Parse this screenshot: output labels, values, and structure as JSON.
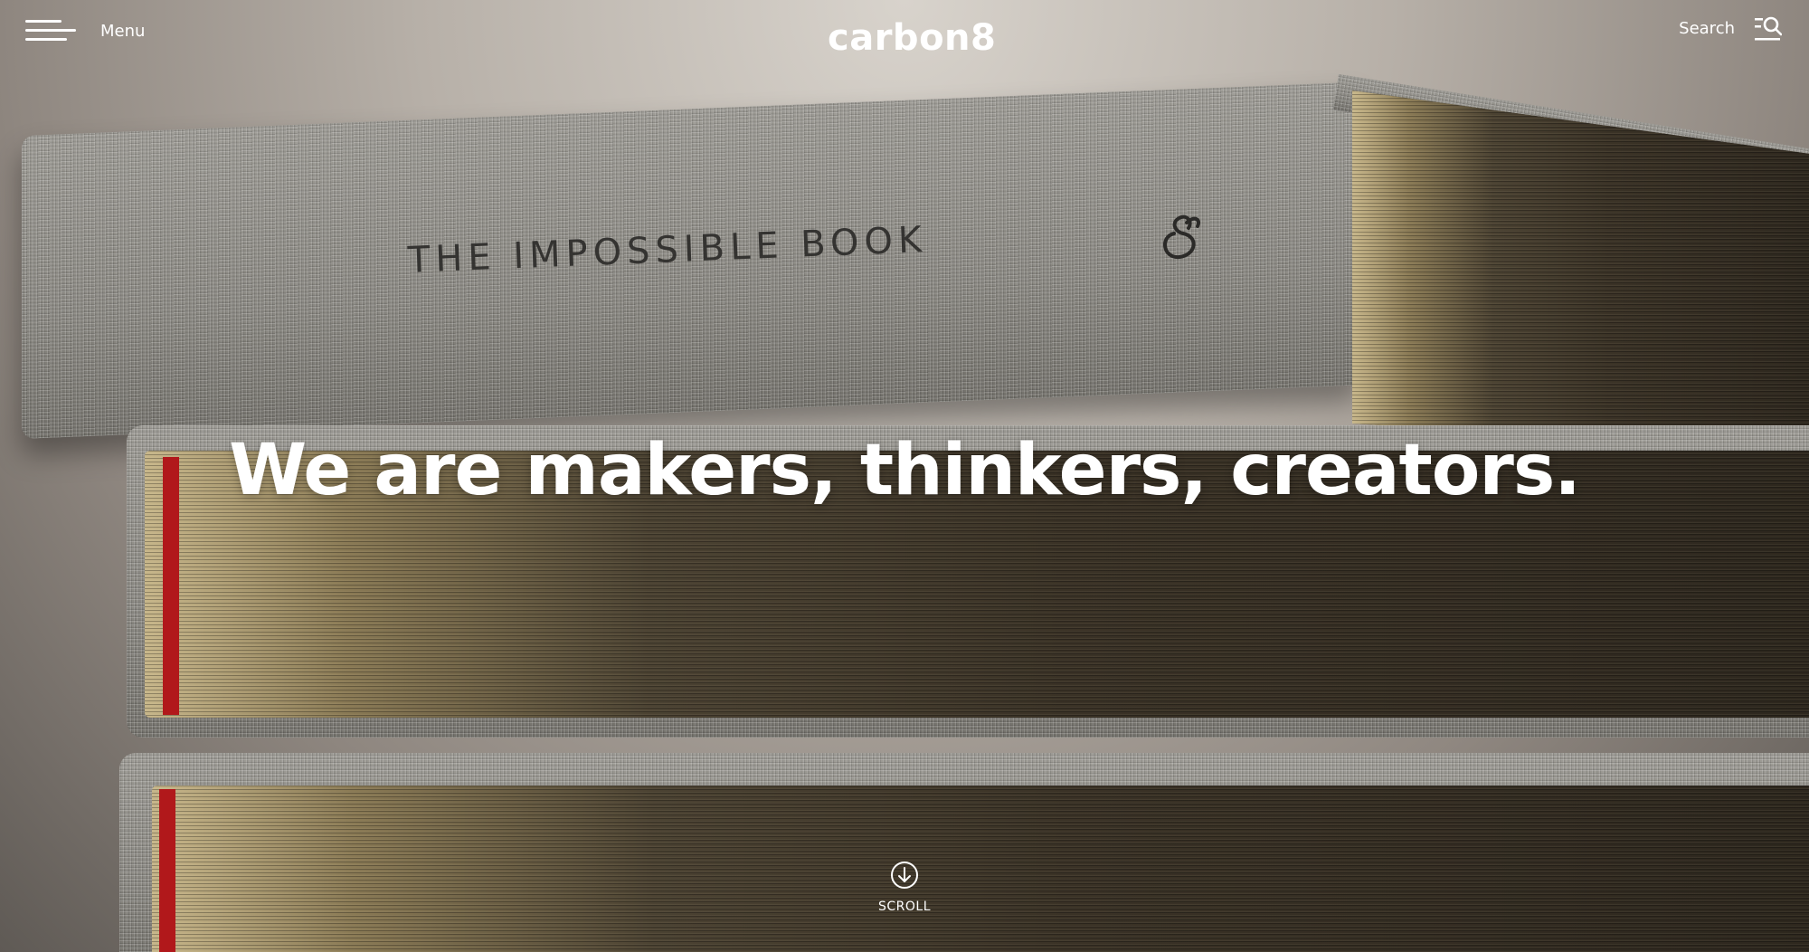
{
  "header": {
    "menu_label": "Menu",
    "logo_text": "carbon8",
    "search_label": "Search"
  },
  "hero": {
    "book_spine_title": "THE IMPOSSIBLE BOOK",
    "headline": "We are makers, thinkers, creators.",
    "scroll_label": "SCROLL"
  },
  "colors": {
    "text": "#ffffff",
    "ribbon_red": "#b1181b"
  },
  "icons": {
    "menu": "hamburger-menu-icon",
    "search": "search-icon",
    "scroll": "arrow-down-circle-icon"
  }
}
